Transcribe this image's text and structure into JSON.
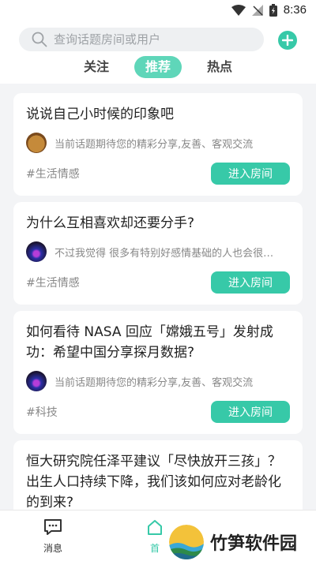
{
  "status": {
    "time": "8:36"
  },
  "search": {
    "placeholder": "查询话题房间或用户"
  },
  "tabs": [
    {
      "label": "关注",
      "active": false
    },
    {
      "label": "推荐",
      "active": true
    },
    {
      "label": "热点",
      "active": false
    }
  ],
  "cards": [
    {
      "title": "说说自己小时候的印象吧",
      "snippet": "当前话题期待您的精彩分享,友善、客观交流",
      "tag": "#生活情感",
      "button": "进入房间"
    },
    {
      "title": "为什么互相喜欢却还要分手?",
      "snippet": "不过我觉得 很多有特别好感情基础的人也会很容易因为一些小事分手",
      "tag": "#生活情感",
      "button": "进入房间"
    },
    {
      "title": "如何看待 NASA 回应「嫦娥五号」发射成功：希望中国分享探月数据?",
      "snippet": "当前话题期待您的精彩分享,友善、客观交流",
      "tag": "#科技",
      "button": "进入房间"
    },
    {
      "title": "恒大研究院任泽平建议「尽快放开三孩」？出生人口持续下降，我们该如何应对老龄化的到来?"
    }
  ],
  "bottom_nav": [
    {
      "label": "消息",
      "icon": "message-icon"
    },
    {
      "label": "首",
      "icon": "home-icon"
    }
  ],
  "watermark": {
    "text": "竹笋软件园"
  },
  "colors": {
    "accent": "#37c9a8",
    "tab_active": "#5fd6b9"
  }
}
